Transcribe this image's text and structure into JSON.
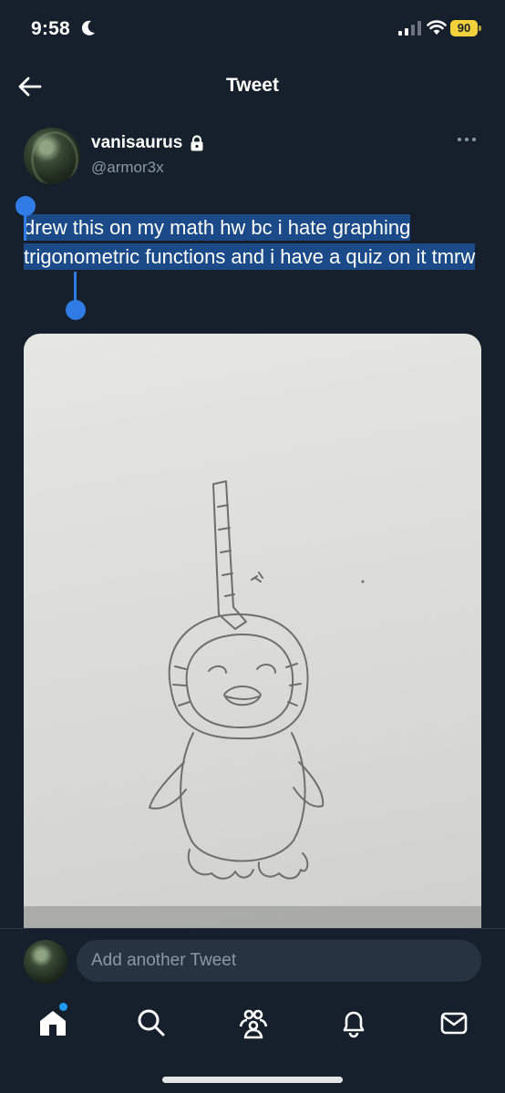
{
  "status": {
    "time": "9:58",
    "battery": "90"
  },
  "header": {
    "title": "Tweet"
  },
  "author": {
    "name": "vanisaurus",
    "handle": "@armor3x"
  },
  "tweet": {
    "text": "drew this on my math hw bc i hate graphing trigonometric functions and i have a quiz on it tmrw"
  },
  "compose": {
    "placeholder": "Add another Tweet"
  },
  "tabs": [
    {
      "icon": "home-icon",
      "active": true,
      "badge": true
    },
    {
      "icon": "search-icon"
    },
    {
      "icon": "communities-icon"
    },
    {
      "icon": "notifications-icon"
    },
    {
      "icon": "messages-icon"
    }
  ],
  "colors": {
    "background": "#16202c",
    "accent": "#1d9bf0",
    "selection": "#1b4a88",
    "selection_handle": "#2f7ce6",
    "battery": "#f2d13a"
  }
}
